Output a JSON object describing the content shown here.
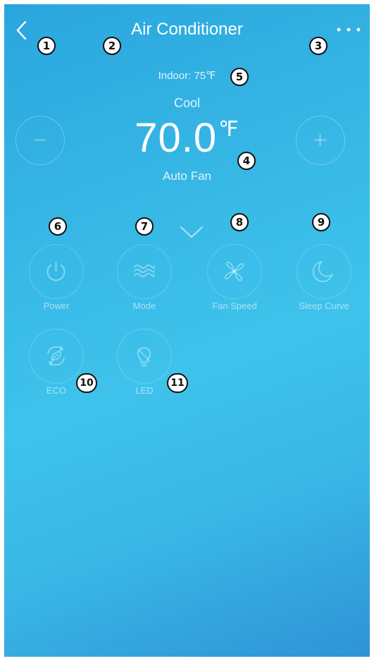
{
  "header": {
    "title": "Air Conditioner"
  },
  "status": {
    "indoor": "Indoor: 75℉",
    "mode": "Cool",
    "temperature": "70.0",
    "temperature_unit": "℉",
    "fan": "Auto Fan"
  },
  "controls": [
    {
      "label": "Power",
      "icon": "power-icon"
    },
    {
      "label": "Mode",
      "icon": "wave-icon"
    },
    {
      "label": "Fan Speed",
      "icon": "fan-icon"
    },
    {
      "label": "Sleep Curve",
      "icon": "moon-icon"
    },
    {
      "label": "ECO",
      "icon": "eco-icon"
    },
    {
      "label": "LED",
      "icon": "bulb-icon"
    }
  ],
  "annotations": [
    "1",
    "2",
    "3",
    "4",
    "5",
    "6",
    "7",
    "8",
    "9",
    "10",
    "11"
  ],
  "colors": {
    "gradient_top": "#2aa6de",
    "gradient_mid": "#3ec3ec",
    "gradient_bottom": "#2e93d6",
    "text": "#ffffff"
  }
}
